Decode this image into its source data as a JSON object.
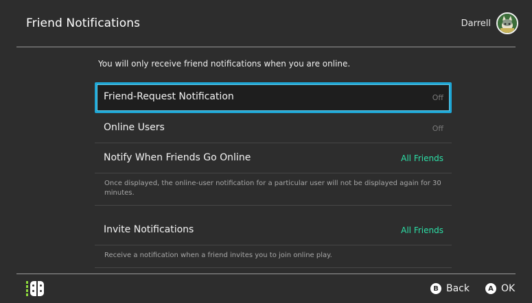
{
  "header": {
    "title": "Friend Notifications",
    "user_name": "Darrell",
    "avatar_icon": "character-avatar-icon"
  },
  "intro_text": "You will only receive friend notifications when you are online.",
  "settings": [
    {
      "label": "Friend-Request Notification",
      "value": "Off",
      "enabled": false,
      "selected": true
    },
    {
      "label": "Online Users",
      "value": "Off",
      "enabled": false,
      "selected": false
    },
    {
      "label": "Notify When Friends Go Online",
      "value": "All Friends",
      "enabled": true,
      "selected": false,
      "description": "Once displayed, the online-user notification for a particular user will not be displayed again for 30 minutes."
    },
    {
      "label": "Invite Notifications",
      "value": "All Friends",
      "enabled": true,
      "selected": false,
      "description": "Receive a notification when a friend invites you to join online play."
    }
  ],
  "footer": {
    "back_button": "B",
    "back_label": "Back",
    "ok_button": "A",
    "ok_label": "OK",
    "controller_icon": "joycon-icon"
  },
  "colors": {
    "background": "#2d2d2d",
    "selection": "#1fa7d6",
    "on_value": "#2de1a8",
    "off_value": "#7a7a7a",
    "battery": "#8fdc3c"
  }
}
